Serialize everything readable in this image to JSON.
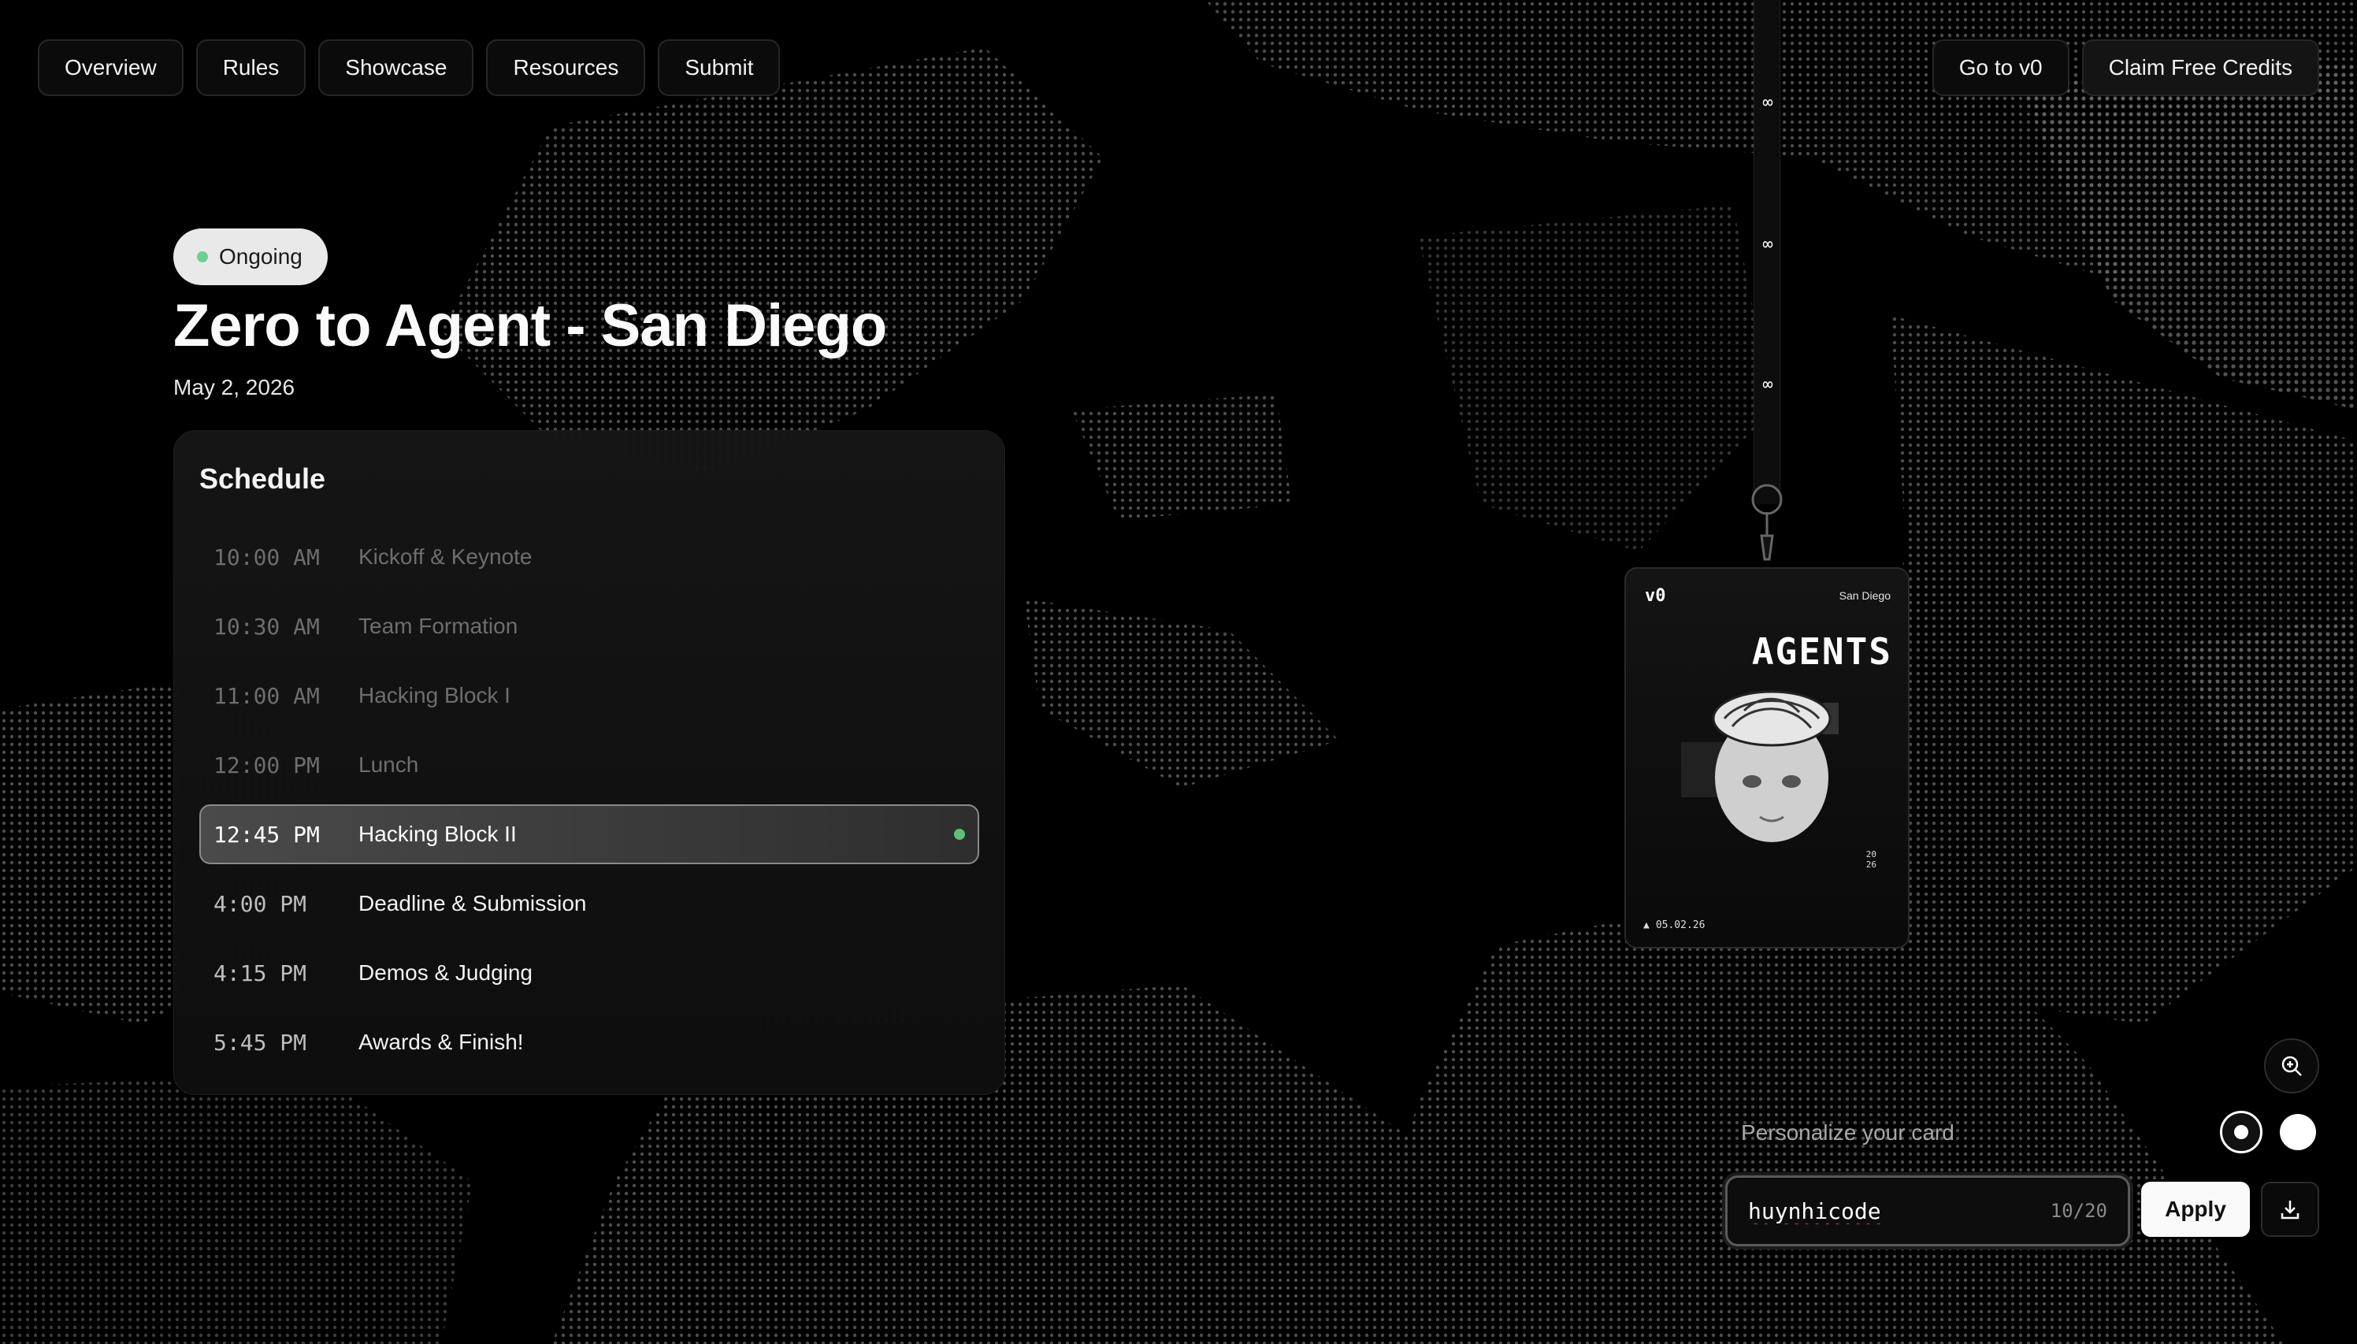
{
  "nav": {
    "left": [
      {
        "label": "Overview"
      },
      {
        "label": "Rules"
      },
      {
        "label": "Showcase"
      },
      {
        "label": "Resources"
      },
      {
        "label": "Submit"
      }
    ],
    "right": [
      {
        "label": "Go to v0"
      },
      {
        "label": "Claim Free Credits"
      }
    ]
  },
  "event": {
    "status": "Ongoing",
    "title": "Zero to Agent - San Diego",
    "date": "May 2, 2026"
  },
  "schedule": {
    "title": "Schedule",
    "items": [
      {
        "time": "10:00 AM",
        "name": "Kickoff & Keynote",
        "state": "past"
      },
      {
        "time": "10:30 AM",
        "name": "Team Formation",
        "state": "past"
      },
      {
        "time": "11:00 AM",
        "name": "Hacking Block I",
        "state": "past"
      },
      {
        "time": "12:00 PM",
        "name": "Lunch",
        "state": "past"
      },
      {
        "time": "12:45 PM",
        "name": "Hacking Block II",
        "state": "current"
      },
      {
        "time": "4:00 PM",
        "name": "Deadline & Submission",
        "state": "future"
      },
      {
        "time": "4:15 PM",
        "name": "Demos & Judging",
        "state": "future"
      },
      {
        "time": "5:45 PM",
        "name": "Awards & Finish!",
        "state": "future"
      }
    ]
  },
  "badge": {
    "logo": "v0",
    "city": "San Diego",
    "title": "AGENTS",
    "date": "05.02.26",
    "year_top": "20",
    "year_bottom": "26"
  },
  "personalize": {
    "label": "Personalize your card",
    "input_value": "huynhicode",
    "char_count": "10/20",
    "apply_label": "Apply",
    "swatches": [
      "dark",
      "light"
    ],
    "selected_swatch": "dark"
  },
  "colors": {
    "background": "#000000",
    "status_dot": "#6fcf8f",
    "live_dot": "#5fbf7a",
    "apply_bg": "#fafafa"
  },
  "icons": {
    "zoom": "zoom-in-icon",
    "download": "download-icon"
  }
}
